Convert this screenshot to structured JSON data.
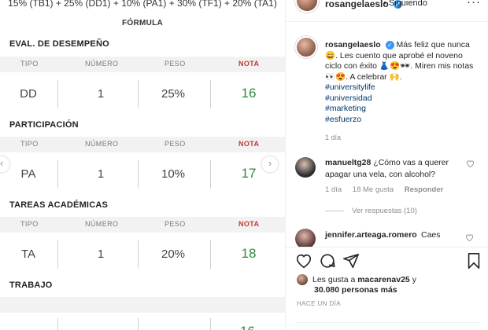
{
  "sheet": {
    "formula_text": "15% (TB1) + 25% (DD1) + 10% (PA1) + 30% (TF1) + 20% (TA1)",
    "formula_label": "FÓRMULA",
    "headers": {
      "tipo": "TIPO",
      "numero": "NÚMERO",
      "peso": "PESO",
      "nota": "NOTA"
    },
    "sections": [
      {
        "title": "EVAL. DE DESEMPEÑO",
        "tipo": "DD",
        "numero": "1",
        "peso": "25%",
        "nota": "16"
      },
      {
        "title": "PARTICIPACIÓN",
        "tipo": "PA",
        "numero": "1",
        "peso": "10%",
        "nota": "17"
      },
      {
        "title": "TAREAS ACADÉMICAS",
        "tipo": "TA",
        "numero": "1",
        "peso": "20%",
        "nota": "18"
      },
      {
        "title": "TRABAJO"
      }
    ],
    "nav_prev": "‹",
    "nav_next": "›"
  },
  "post": {
    "username": "rosangelaeslo",
    "verified_mark": "✓",
    "follow_text": "• Siguiendo",
    "more": "···",
    "caption_text": "Más feliz que nunca 😄. Les cuento que aprobé el noveno ciclo con éxito 👗😍🕶. Miren mis notas 👀😍. A celebrar 🙌.",
    "hashtags": [
      "#universitylife",
      "#universidad",
      "#marketing",
      "#esfuerzo"
    ],
    "caption_time": "1 día"
  },
  "comments": [
    {
      "username": "manueltg28",
      "text": "¿Cómo vas a querer apagar una vela, con alcohol?",
      "time": "1 día",
      "likes": "18 Me gusta",
      "reply": "Responder",
      "view_replies": "Ver respuestas (10)"
    },
    {
      "username": "jennifer.arteaga.romero",
      "text": "Caes"
    }
  ],
  "footer": {
    "likes_prefix": "Les gusta a",
    "likes_user": "macarenav25",
    "likes_and": "y",
    "likes_count": "30.080 personas más",
    "time": "HACE UN DÍA"
  },
  "icons": [
    "heart-icon",
    "comment-icon",
    "share-icon",
    "bookmark-icon",
    "verified-icon",
    "more-icon"
  ],
  "colors": {
    "nota_green": "#2e8b3a",
    "nota_header_red": "#c0392b",
    "hashtag_blue": "#00376b",
    "verified_blue": "#3897f0"
  }
}
